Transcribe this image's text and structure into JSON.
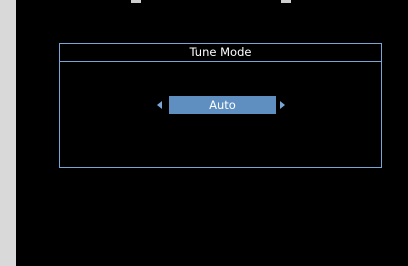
{
  "dialog": {
    "title": "Tune Mode",
    "selected_value": "Auto",
    "prev_icon": "triangle-left",
    "next_icon": "triangle-right"
  },
  "colors": {
    "background": "#000000",
    "frame": "#7aa6d6",
    "highlight": "#5f8fc0",
    "text": "#ffffff"
  }
}
